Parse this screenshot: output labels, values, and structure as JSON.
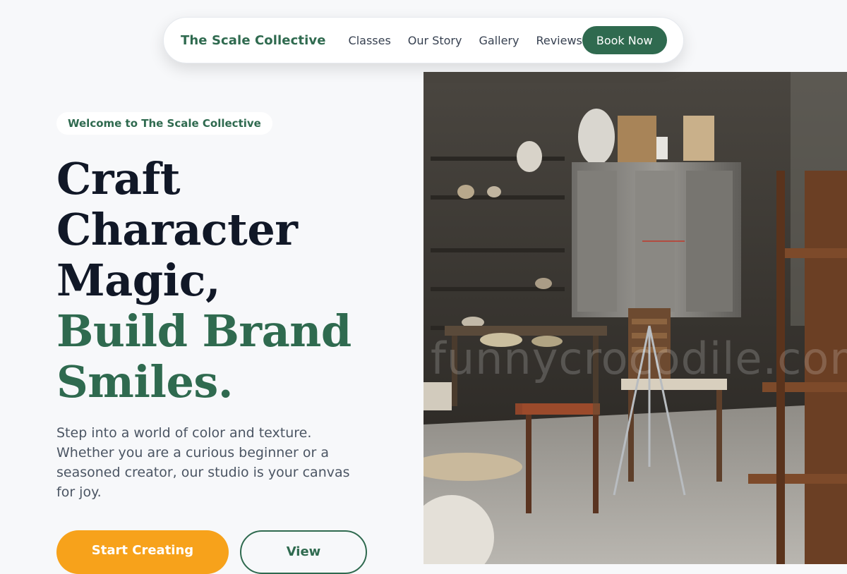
{
  "nav": {
    "brand": "The Scale Collective",
    "links": [
      "Classes",
      "Our Story",
      "Gallery",
      "Reviews"
    ],
    "book_label": "Book Now"
  },
  "hero": {
    "eyebrow": "Welcome to The Scale Collective",
    "headline_dark": [
      "Craft",
      "Character",
      "Magic,"
    ],
    "headline_green": [
      "Build Brand",
      "Smiles."
    ],
    "lead": "Step into a world of color and texture. Whether you are a curious beginner or a seasoned creator, our studio is your canvas for joy.",
    "primary_cta": "Start Creating",
    "secondary_cta": "View",
    "image_watermark": "funnycrocodile.com"
  },
  "colors": {
    "brand_green": "#2f6a4f",
    "accent_orange": "#f7a21b",
    "background": "#f7f8fa"
  }
}
